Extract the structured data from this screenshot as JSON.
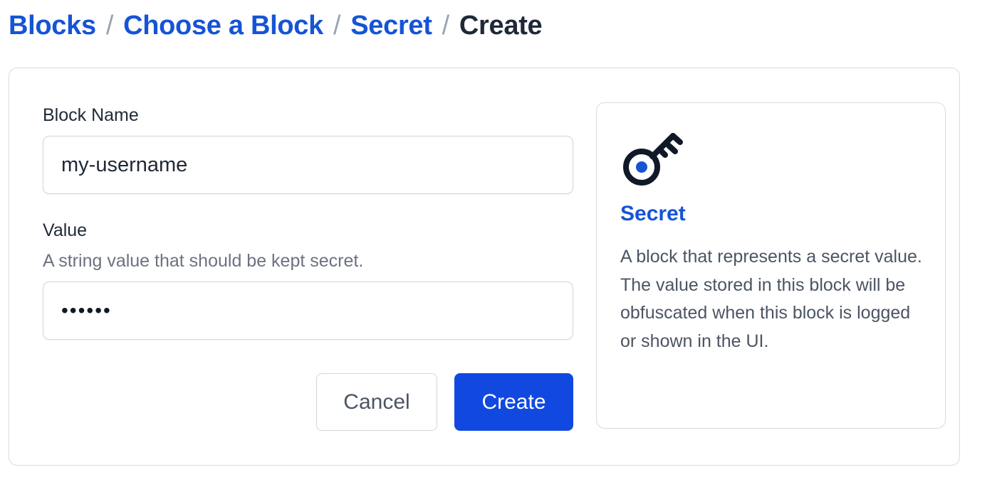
{
  "breadcrumb": {
    "items": [
      "Blocks",
      "Choose a Block",
      "Secret"
    ],
    "separator": "/",
    "current": "Create"
  },
  "form": {
    "block_name": {
      "label": "Block Name",
      "value": "my-username"
    },
    "value": {
      "label": "Value",
      "description": "A string value that should be kept secret.",
      "masked_value": "••••••"
    },
    "cancel_label": "Cancel",
    "create_label": "Create"
  },
  "info": {
    "icon": "key-icon",
    "title": "Secret",
    "description": "A block that represents a secret value. The value stored in this block will be obfuscated when this block is logged or shown in the UI."
  },
  "colors": {
    "link": "#1554d6",
    "primary_button": "#1148e0",
    "icon_accent": "#1554d6",
    "icon_dark": "#111827"
  }
}
